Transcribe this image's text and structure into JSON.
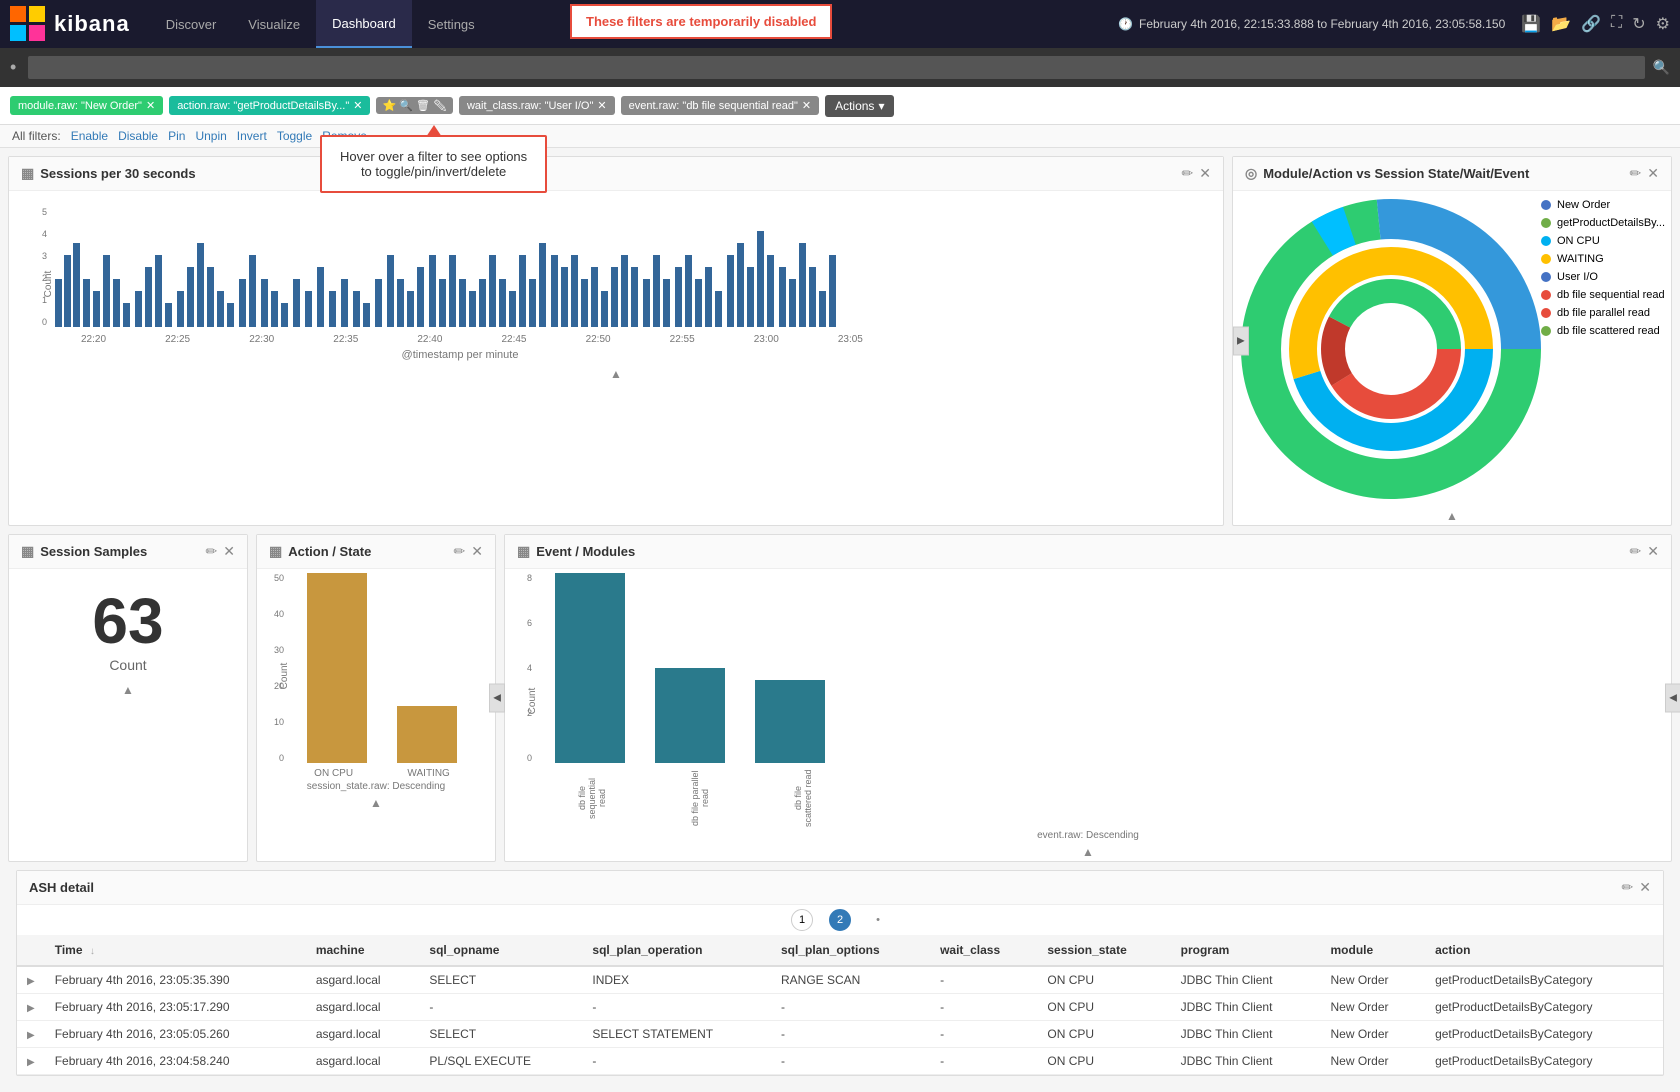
{
  "nav": {
    "logo_text": "kibana",
    "items": [
      "Discover",
      "Visualize",
      "Dashboard",
      "Settings"
    ],
    "active": "Dashboard",
    "time_range": "February 4th 2016, 22:15:33.888 to February 4th 2016, 23:05:58.150"
  },
  "filter_warning": {
    "text": "These filters are temporarily disabled"
  },
  "search": {
    "placeholder": "",
    "value": "•"
  },
  "filters": {
    "pills": [
      {
        "label": "module.raw: \"New Order\"",
        "type": "green"
      },
      {
        "label": "action.raw: \"getProductDetailsBy...\"",
        "type": "teal"
      },
      {
        "label": "",
        "type": "gray"
      },
      {
        "label": "wait_class.raw: \"User I/O\"",
        "type": "gray"
      },
      {
        "label": "event.raw: \"db file sequential read\"",
        "type": "gray"
      }
    ],
    "actions_label": "Actions",
    "all_filters_label": "All filters:",
    "filter_links": [
      "Enable",
      "Disable",
      "Pin",
      "Unpin",
      "Invert",
      "Toggle",
      "Remove"
    ]
  },
  "tooltip": {
    "text": "Hover over a filter to see options\nto toggle/pin/invert/delete"
  },
  "sessions_panel": {
    "title": "Sessions per 30 seconds",
    "bars": [
      60,
      80,
      100,
      60,
      40,
      80,
      60,
      20,
      40,
      60,
      80,
      20,
      40,
      60,
      80,
      60,
      40,
      20,
      60,
      80,
      60,
      40,
      20,
      60,
      100,
      80,
      60,
      80,
      60,
      40,
      60,
      80,
      60,
      40,
      60,
      80,
      60,
      80,
      60,
      40,
      60,
      80,
      60,
      40,
      80,
      60,
      80,
      40,
      60,
      80
    ],
    "y_labels": [
      "5",
      "4",
      "3",
      "2",
      "1",
      "0"
    ],
    "x_labels": [
      "22:20",
      "22:25",
      "22:30",
      "22:35",
      "22:40",
      "22:45",
      "22:50",
      "22:55",
      "23:00",
      "23:05"
    ],
    "x_axis_title": "@timestamp per minute"
  },
  "donut_panel": {
    "title": "Module/Action vs Session State/Wait/Event",
    "legend": [
      {
        "label": "New Order",
        "color": "#4472c4"
      },
      {
        "label": "getProductDetailsBy...",
        "color": "#70ad47"
      },
      {
        "label": "ON CPU",
        "color": "#00b0f0"
      },
      {
        "label": "WAITING",
        "color": "#ffc000"
      },
      {
        "label": "User I/O",
        "color": "#4472c4"
      },
      {
        "label": "db file sequential read",
        "color": "#e74c3c"
      },
      {
        "label": "db file parallel read",
        "color": "#e74c3c"
      },
      {
        "label": "db file scattered read",
        "color": "#70ad47"
      }
    ]
  },
  "session_samples": {
    "title": "Session Samples",
    "big_number": "63",
    "label": "Count"
  },
  "action_state": {
    "title": "Action / State",
    "bars": [
      {
        "label": "ON CPU",
        "value": 50,
        "color": "#c8973e"
      },
      {
        "label": "WAITING",
        "value": 15,
        "color": "#c8973e"
      }
    ],
    "x_axis_title": "session_state.raw: Descending",
    "y_label": "Count",
    "y_max": 50,
    "y_ticks": [
      "50",
      "40",
      "30",
      "20",
      "10",
      "0"
    ]
  },
  "event_modules": {
    "title": "Event / Modules",
    "bars": [
      {
        "label": "db file sequential read",
        "value": 8
      },
      {
        "label": "db file parallel read",
        "value": 4
      },
      {
        "label": "db file scattered read",
        "value": 3.5
      }
    ],
    "x_axis_title": "event.raw: Descending",
    "y_label": "Count",
    "y_max": 8,
    "y_ticks": [
      "8",
      "6",
      "4",
      "2",
      "0"
    ]
  },
  "ash_detail": {
    "title": "ASH detail",
    "pages": [
      "1",
      "2",
      "•"
    ],
    "columns": [
      "Time",
      "machine",
      "sql_opname",
      "sql_plan_operation",
      "sql_plan_options",
      "wait_class",
      "session_state",
      "program",
      "module",
      "action"
    ],
    "rows": [
      {
        "time": "February 4th 2016, 23:05:35.390",
        "machine": "asgard.local",
        "sql_opname": "SELECT",
        "sql_plan_operation": "INDEX",
        "sql_plan_options": "RANGE SCAN",
        "wait_class": "-",
        "session_state": "ON CPU",
        "program": "JDBC Thin Client",
        "module": "New Order",
        "action": "getProductDetailsByCategory"
      },
      {
        "time": "February 4th 2016, 23:05:17.290",
        "machine": "asgard.local",
        "sql_opname": "-",
        "sql_plan_operation": "-",
        "sql_plan_options": "-",
        "wait_class": "-",
        "session_state": "ON CPU",
        "program": "JDBC Thin Client",
        "module": "New Order",
        "action": "getProductDetailsByCategory"
      },
      {
        "time": "February 4th 2016, 23:05:05.260",
        "machine": "asgard.local",
        "sql_opname": "SELECT",
        "sql_plan_operation": "SELECT STATEMENT",
        "sql_plan_options": "-",
        "wait_class": "-",
        "session_state": "ON CPU",
        "program": "JDBC Thin Client",
        "module": "New Order",
        "action": "getProductDetailsByCategory"
      },
      {
        "time": "February 4th 2016, 23:04:58.240",
        "machine": "asgard.local",
        "sql_opname": "PL/SQL EXECUTE",
        "sql_plan_operation": "-",
        "sql_plan_options": "-",
        "wait_class": "-",
        "session_state": "ON CPU",
        "program": "JDBC Thin Client",
        "module": "New Order",
        "action": "getProductDetailsByCategory"
      }
    ]
  }
}
